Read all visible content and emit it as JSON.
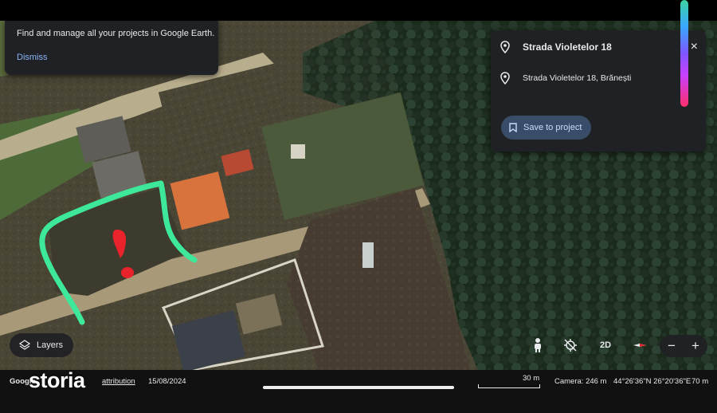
{
  "notice": {
    "message": "Find and manage all your projects in Google Earth.",
    "dismiss_label": "Dismiss"
  },
  "place_card": {
    "title": "Strada Violetelor 18",
    "address": "Strada Violetelor 18, Brănești",
    "save_label": "Save to project",
    "close_glyph": "×"
  },
  "controls": {
    "layers_label": "Layers",
    "view_mode": "2D",
    "zoom_out": "−",
    "zoom_in": "+"
  },
  "status": {
    "google": "Google",
    "attribution": "attribution",
    "date": "15/08/2024",
    "scale": "30 m",
    "camera": "Camera: 246 m",
    "coords": "44°26'36\"N 26°20'36\"E",
    "altitude": "70 m"
  },
  "watermark": "storia",
  "icons": {
    "pin": "pin-icon",
    "bookmark": "bookmark-icon",
    "layers": "layers-icon",
    "pegman": "pegman-icon",
    "gps_off": "gps-off-icon",
    "compass": "compass-icon"
  },
  "colors": {
    "accent": "#8ab4f8",
    "save_bg": "#394c68",
    "green_outline": "#3ee89a",
    "red_mark": "#e8232b"
  }
}
